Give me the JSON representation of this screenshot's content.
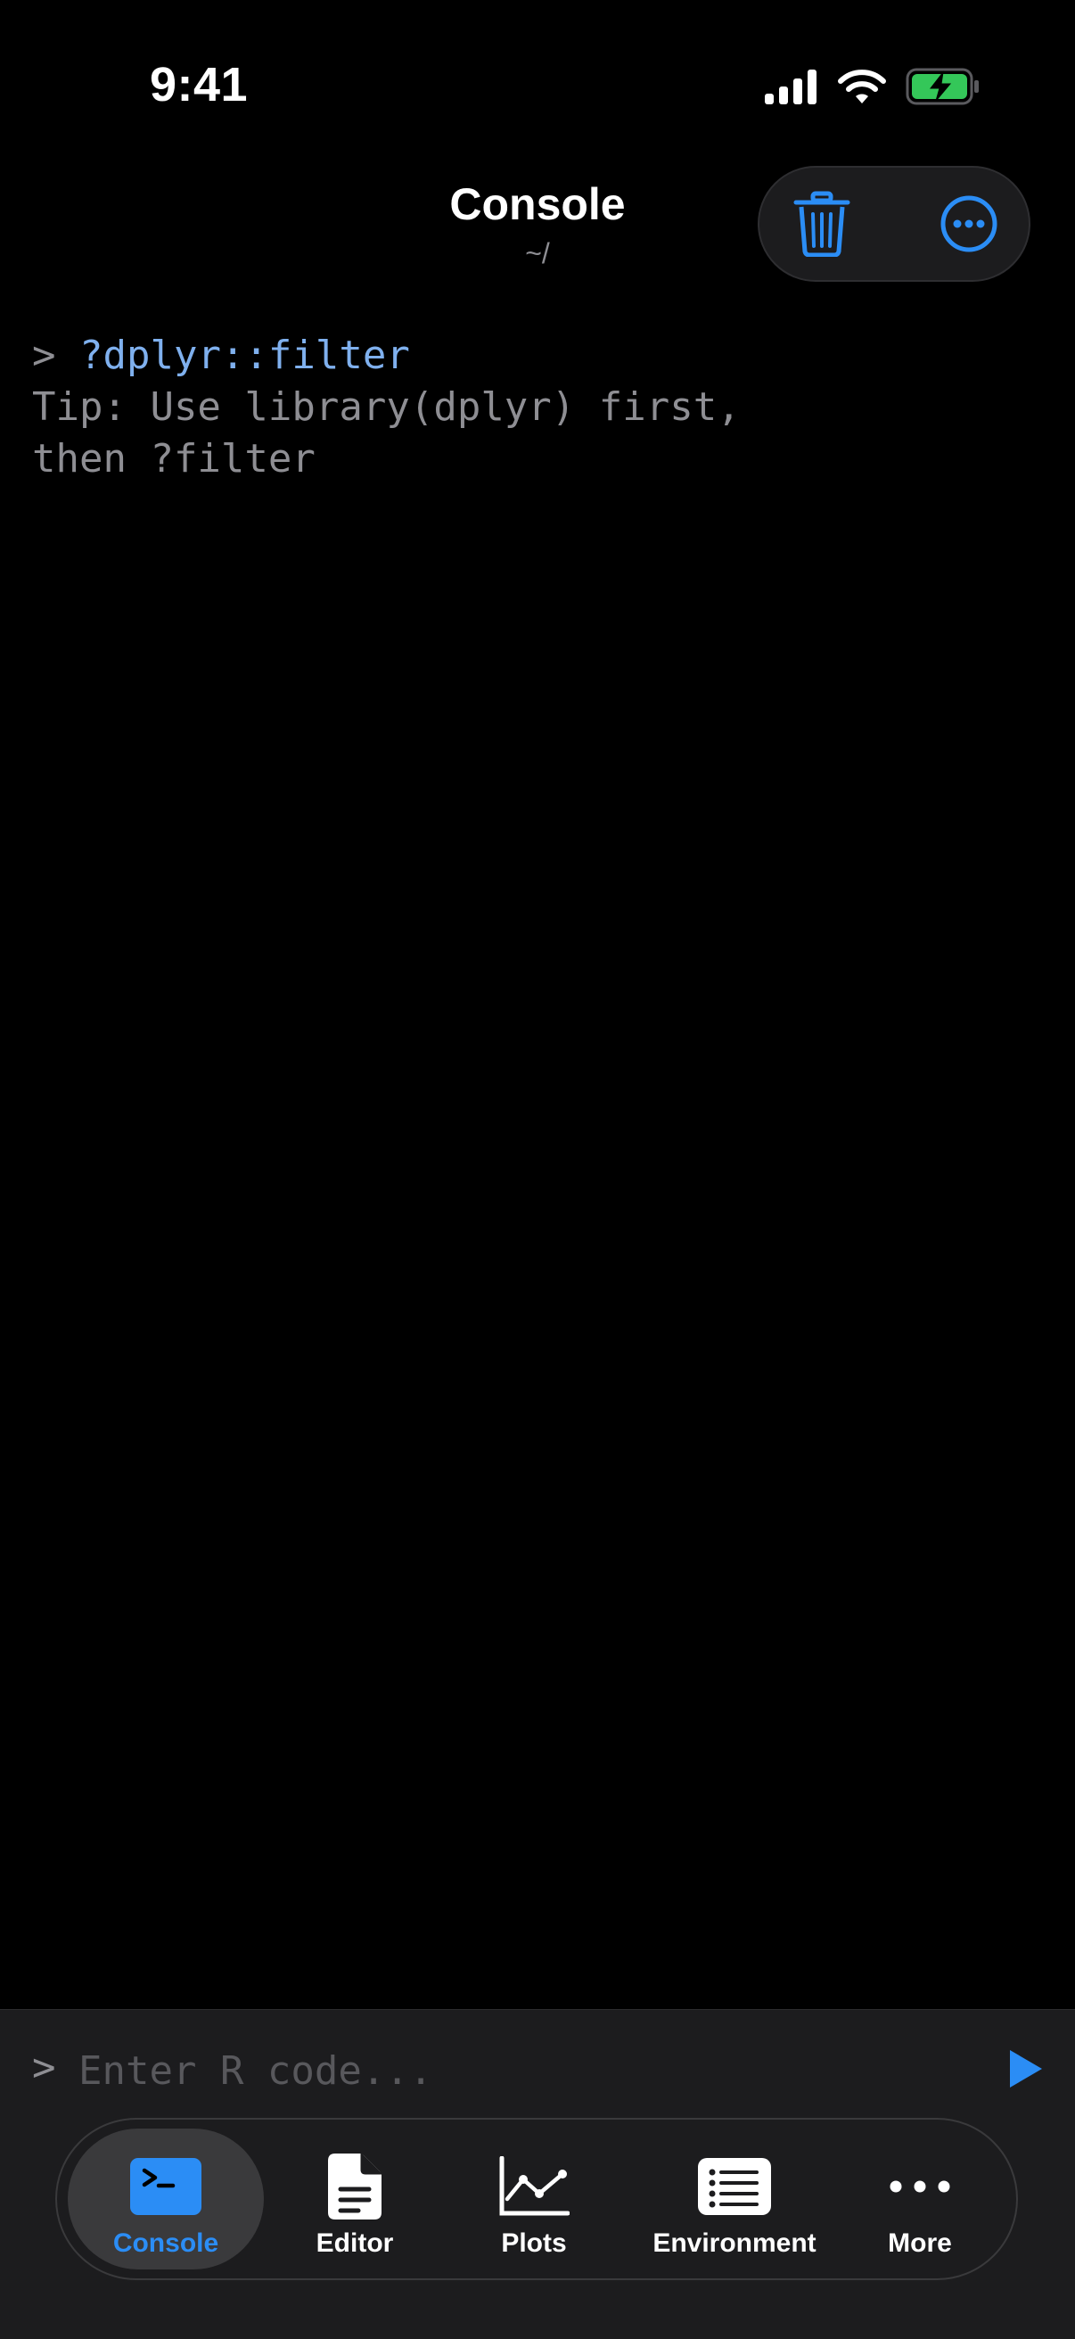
{
  "status_bar": {
    "time": "9:41",
    "icons": [
      "cellular-signal-icon",
      "wifi-icon",
      "battery-charging-icon"
    ]
  },
  "header": {
    "title": "Console",
    "subtitle": "~/",
    "actions": [
      "trash-icon",
      "ellipsis-circle-icon"
    ]
  },
  "console": {
    "prompt": ">",
    "command": "?dplyr::filter",
    "output_lines": [
      "Tip: Use library(dplyr) first,",
      "then ?filter"
    ]
  },
  "input": {
    "prompt": ">",
    "value": "",
    "placeholder": "Enter R code..."
  },
  "tabs": [
    {
      "label": "Console",
      "icon": "terminal-icon",
      "active": true
    },
    {
      "label": "Editor",
      "icon": "document-icon",
      "active": false
    },
    {
      "label": "Plots",
      "icon": "chart-line-icon",
      "active": false
    },
    {
      "label": "Environment",
      "icon": "list-icon",
      "active": false
    },
    {
      "label": "More",
      "icon": "ellipsis-icon",
      "active": false
    }
  ],
  "colors": {
    "accent": "#2b8df5",
    "command_text": "#7fb0ee",
    "muted_text": "#8e8e93",
    "background": "#000000",
    "panel": "#1c1c1e",
    "battery": "#34c759"
  }
}
